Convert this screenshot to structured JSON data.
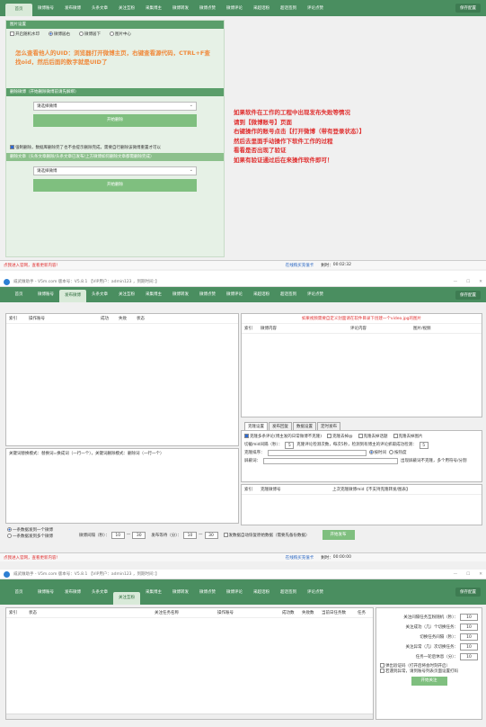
{
  "win1": {
    "tabs": [
      "首页",
      "微博账号",
      "发布微博",
      "头条文章",
      "关注互粉",
      "采集博主",
      "微博转发",
      "微博点赞",
      "微博评论",
      "采超话粉",
      "超话签到",
      "评论点赞"
    ],
    "right_button": "保存配置",
    "img_settings": {
      "head": "图片设置",
      "opt_check": "开启随机水印",
      "opt1": "微博居右",
      "opt2": "微博居下",
      "opt3": "图片中心"
    },
    "uid_help": "怎么查看他人的UID：浏览器打开微博主页，右键查看源代码，CTRL+F查找oid，然后后面的数字就是UID了",
    "del_head": "删除微博（开始删除微博前请先解绑）",
    "select1": "请选择微博",
    "btn_delete": "开始删除",
    "del_check": "强制删除，数据库删除完了也不会提示删除完成，需要自行删除该微博重置才可以",
    "del_head2": "删除文章（头条文章删除/头条文章已发布/上方微博如何删除文章都需删除完成）",
    "select2": "请选择微博",
    "btn_delete2": "开始删除",
    "notice": [
      "如果软件在工作的工程中出现发布失败等情况",
      "请到【微博账号】页面",
      "右键操作的账号点击【打开微博（带有登录状态）】",
      "然后去里面手动操作下软件工作的过程",
      "看看是否出现了验证",
      "如果有验证通过后在来操作软件即可！"
    ],
    "status_left": "点我进入官网，查看更新内容!",
    "status_mid": "在线购买充值卡",
    "status_time_label": "剩时：",
    "status_time": "00:02:32"
  },
  "win2": {
    "title": "威武做助手 - V5m.com  版本号：V5.8.1    【VIP用户：admin123 ，到期时间：】",
    "tabs": [
      "首页",
      "微博账号",
      "发布微博",
      "头条文章",
      "关注互粉",
      "采集博主",
      "微博转发",
      "微博点赞",
      "微博评论",
      "采超话粉",
      "超话签到",
      "评论点赞"
    ],
    "right_button": "保存配置",
    "left_cols": [
      "索引",
      "操作账号",
      "成功",
      "失败",
      "状态"
    ],
    "repl_label": "关键词替换模式：替换词=换成词（一行一个），关键词删除模式：删除词（一行一个）",
    "radio1": "一条数据发到一个微博",
    "radio2": "一条数据发到多个微博",
    "interval_label": "微博间隔（秒）：",
    "interval_a": "10",
    "interval_b": "30",
    "wait_label": "发布等待（分）：",
    "wait_a": "10",
    "wait_b": "30",
    "dup_check": "发数据自动恢复原始数据（需要先备份数据）",
    "btn_publish": "开始发布",
    "right_head": "如果视频需要自定义封面请在软件目录下创建一个video.jpg的图片",
    "right_cols": [
      "索引",
      "微博内容",
      "评论内容",
      "图片/视频"
    ],
    "subtabs": [
      "克隆设置",
      "发布回复",
      "数据设置",
      "定时发布"
    ],
    "clone_check1": "克隆多条评论(博主发的日常微博不克隆)",
    "clone_check2": "克隆去掉@",
    "clone_check3": "克隆去掉话题",
    "clone_check4": "克隆去掉图片",
    "clone_id_label": "切截mid间隔（秒）：",
    "clone_id_val": "5",
    "clone_detect": "克隆评论检测次数，每次5秒，检测到有博主的评论抓取成功检测：",
    "clone_detect_val": "5",
    "clone_kw_label": "克隆排序：",
    "r_on": "按时间",
    "r_off": "按热度",
    "blogger_label": "屏蔽词：",
    "blogger_hint": "出现屏蔽词不克隆，多个用符号/分割",
    "bottom_cols": [
      "索引",
      "克隆微博号",
      "上次克隆微博mid【不支持克隆转发/图表】"
    ],
    "status_left": "点我进入官网，查看更新内容!",
    "status_mid": "在线购买充值卡",
    "status_time_label": "剩时：",
    "status_time": "00:00:00"
  },
  "win3": {
    "title": "威武做助手 - V5m.com  版本号：V5.8.1    【VIP用户：admin123 ，到期时间：】",
    "tabs": [
      "首页",
      "微博账号",
      "发布微博",
      "头条文章",
      "关注互粉",
      "采集博主",
      "微博转发",
      "微博点赞",
      "微博评论",
      "采超话粉",
      "超话签到",
      "评论点赞"
    ],
    "right_button": "保存配置",
    "cols": [
      "索引",
      "状态",
      "关注任务名称",
      "操作账号",
      "成功数",
      "失败数",
      "当前日任务数",
      "任务"
    ],
    "settings": [
      {
        "label": "关注间隔任务互粉随机（秒）：",
        "value": "10"
      },
      {
        "label": "关注成功（几）个切换任务：",
        "value": "10"
      },
      {
        "label": "切换任务间隔（秒）：",
        "value": "10"
      },
      {
        "label": "关注异常（几）次切换任务：",
        "value": "10"
      },
      {
        "label": "任务一轮后休息（分）：",
        "value": "10"
      }
    ],
    "chk1": "弹出验证码（打开后将会时刻开启）",
    "chk2": "若遇到异常，请到账号列表页面设置打码",
    "btn_start": "开始关注"
  },
  "colors": {
    "nav": "#4a8e60",
    "accent": "#7fbf7f",
    "notice": "#e03030"
  }
}
